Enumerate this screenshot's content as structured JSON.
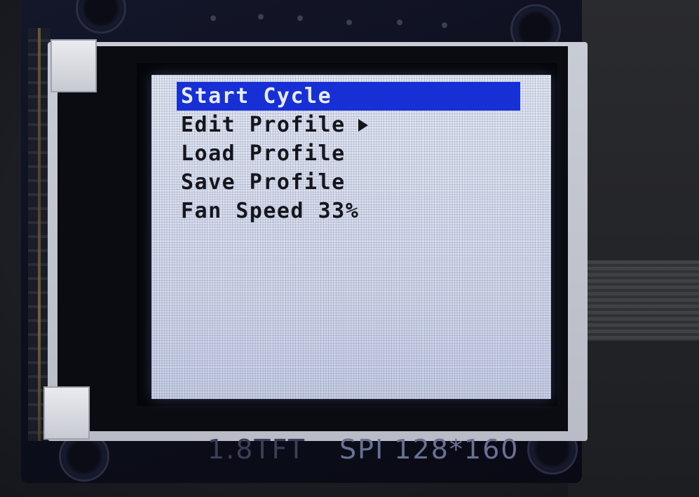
{
  "lcd": {
    "menu": [
      {
        "label": "Start Cycle",
        "selected": true,
        "submenu": false
      },
      {
        "label": "Edit Profile",
        "selected": false,
        "submenu": true
      },
      {
        "label": "Load Profile",
        "selected": false,
        "submenu": false
      },
      {
        "label": "Save Profile",
        "selected": false,
        "submenu": false
      },
      {
        "label": "Fan Speed 33%",
        "selected": false,
        "submenu": false
      }
    ],
    "highlight_color": "#1730d6",
    "submenu_icon": "triangle-right-icon"
  },
  "board": {
    "size_label": "1.8TFT",
    "interface_label": "SPI 128*160"
  }
}
